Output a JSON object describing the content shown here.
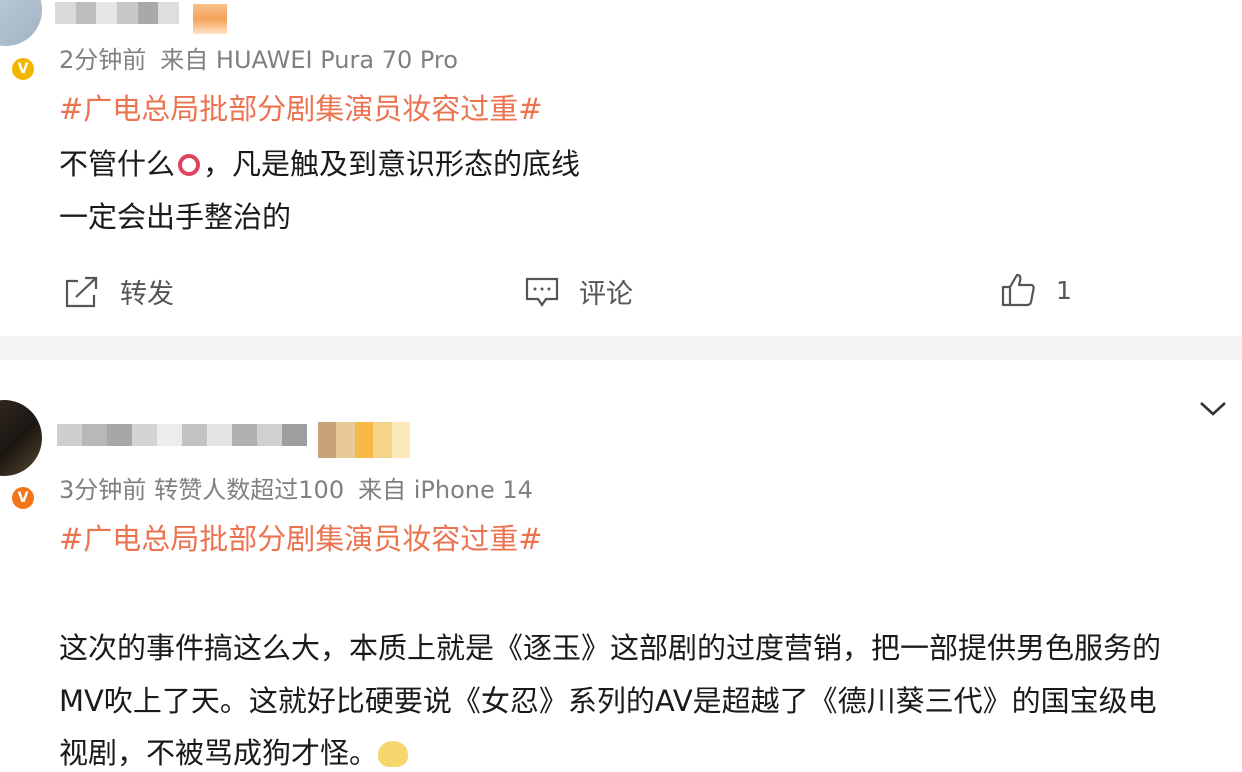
{
  "post1": {
    "meta_time": "2分钟前",
    "meta_source": "来自 HUAWEI Pura 70 Pro",
    "topic": "#广电总局批部分剧集演员妆容过重#",
    "text_line1_a": "不管什么",
    "text_line1_b": "，凡是触及到意识形态的底线",
    "text_line2": "一定会出手整治的",
    "actions": {
      "repost_label": "转发",
      "comment_label": "评论",
      "like_count": "1"
    }
  },
  "post2": {
    "meta_time": "3分钟前",
    "meta_extra": "转赞人数超过100",
    "meta_source": "来自 iPhone 14",
    "topic": "#广电总局批部分剧集演员妆容过重#",
    "text_line1": "这次的事件搞这么大，本质上就是《逐玉》这部剧的过度营销，把一部提供男色服务的",
    "text_line2": "MV吹上了天。这就好比硬要说《女忍》系列的AV是超越了《德川葵三代》的国宝级电",
    "text_line3": "视剧，不被骂成狗才怪。"
  },
  "colors": {
    "topic": "#eb7350",
    "meta": "#808080",
    "verified_gold": "#f2b600",
    "verified_orange": "#f2751a",
    "separator": "#f3f3f3"
  },
  "icons": {
    "repost": "share-arrow-icon",
    "comment": "comment-bubble-icon",
    "like": "thumbs-up-icon",
    "expand": "chevron-down-icon",
    "verified": "verified-v-icon"
  }
}
